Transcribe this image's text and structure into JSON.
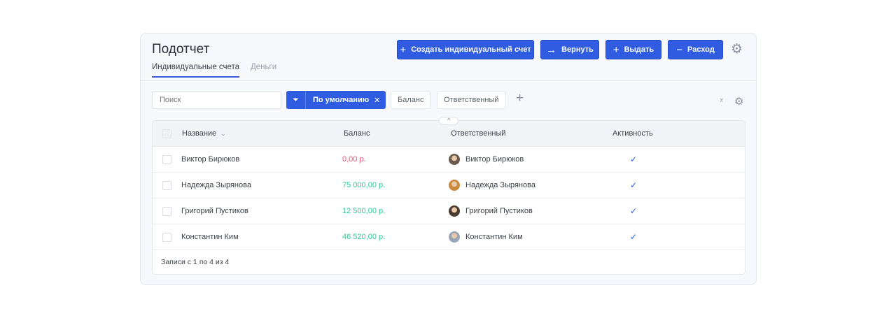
{
  "header": {
    "title": "Подотчет",
    "tabs": [
      {
        "label": "Индивидуальные счета",
        "active": true
      },
      {
        "label": "Деньги",
        "active": false
      }
    ]
  },
  "actions": {
    "create": "Создать индивидуальный счет",
    "return": "Вернуть",
    "issue": "Выдать",
    "expense": "Расход"
  },
  "toolbar": {
    "search_placeholder": "Поиск",
    "filter_preset": "По умолчанию",
    "filter_chips": [
      "Баланс",
      "Ответственный"
    ]
  },
  "table": {
    "columns": [
      "Название",
      "Баланс",
      "Ответственный",
      "Активность"
    ],
    "rows": [
      {
        "name": "Виктор Бирюков",
        "balance": "0,00 р.",
        "balance_color": "#f0557a",
        "owner": "Виктор Бирюков",
        "active": "✓"
      },
      {
        "name": "Надежда Зырянова",
        "balance": "75 000,00 р.",
        "balance_color": "#2ec99a",
        "owner": "Надежда Зырянова",
        "active": "✓"
      },
      {
        "name": "Григорий Пустиков",
        "balance": "12 500,00 р.",
        "balance_color": "#2ec99a",
        "owner": "Григорий Пустиков",
        "active": "✓"
      },
      {
        "name": "Константин Ким",
        "balance": "46 520,00 р.",
        "balance_color": "#2ec99a",
        "owner": "Константин Ким",
        "active": "✓"
      }
    ],
    "footer": "Записи с 1 по 4 из 4"
  },
  "colors": {
    "accent": "#2f5ce0"
  }
}
